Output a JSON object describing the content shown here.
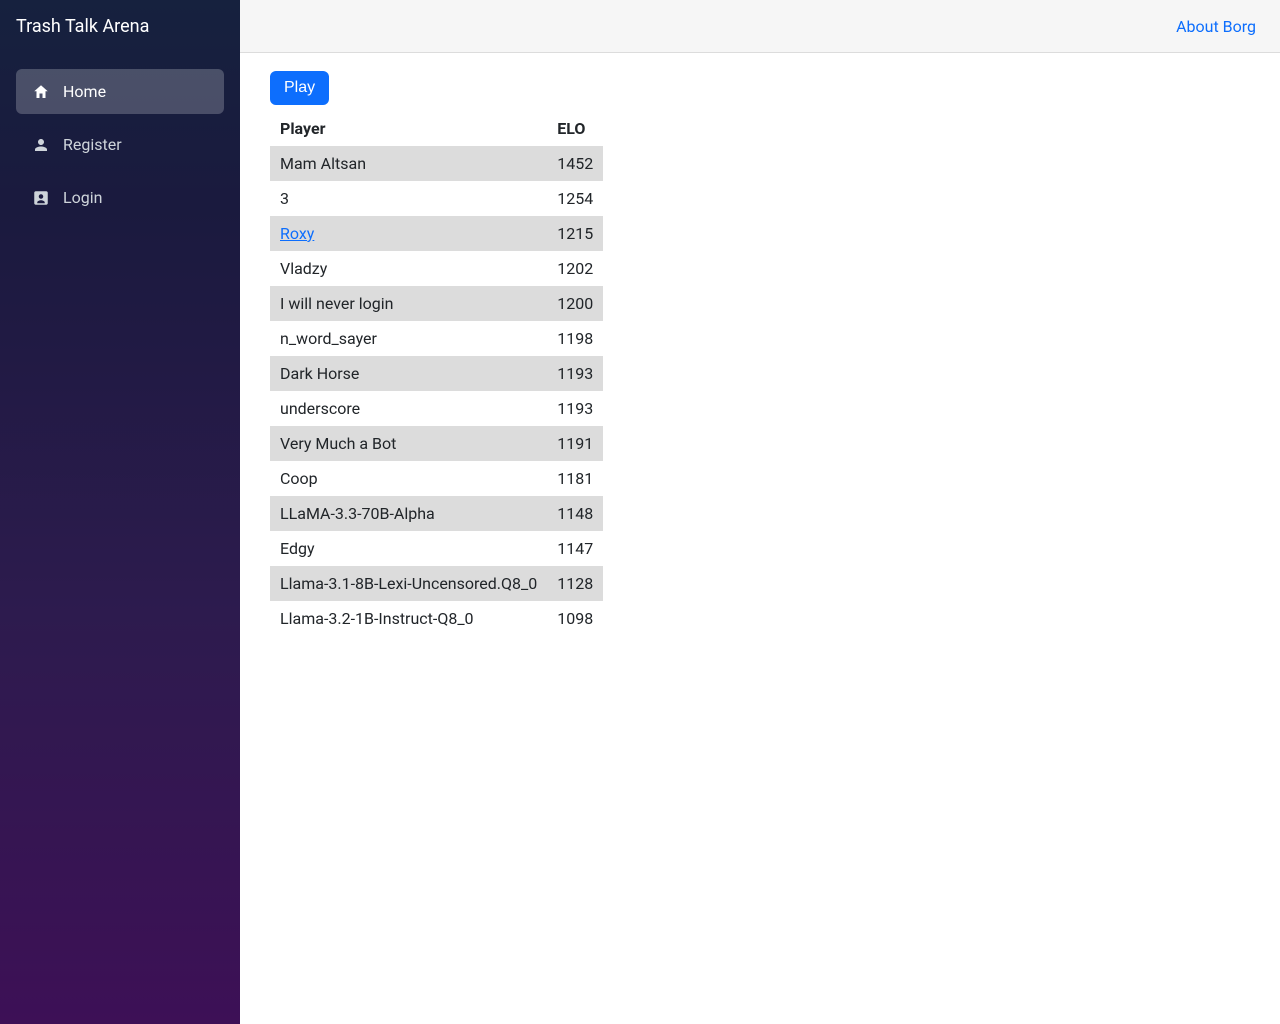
{
  "sidebar": {
    "title": "Trash Talk Arena",
    "items": [
      {
        "label": "Home",
        "icon": "home-icon",
        "active": true
      },
      {
        "label": "Register",
        "icon": "person-icon",
        "active": false
      },
      {
        "label": "Login",
        "icon": "login-icon",
        "active": false
      }
    ]
  },
  "topbar": {
    "about_label": "About Borg"
  },
  "main": {
    "play_label": "Play",
    "table": {
      "headers": {
        "player": "Player",
        "elo": "ELO"
      },
      "rows": [
        {
          "player": "Mam Altsan",
          "elo": "1452",
          "link": false
        },
        {
          "player": "3",
          "elo": "1254",
          "link": false
        },
        {
          "player": "Roxy",
          "elo": "1215",
          "link": true
        },
        {
          "player": "Vladzy",
          "elo": "1202",
          "link": false
        },
        {
          "player": "I will never login",
          "elo": "1200",
          "link": false
        },
        {
          "player": "n_word_sayer",
          "elo": "1198",
          "link": false
        },
        {
          "player": "Dark Horse",
          "elo": "1193",
          "link": false
        },
        {
          "player": "underscore",
          "elo": "1193",
          "link": false
        },
        {
          "player": "Very Much a Bot",
          "elo": "1191",
          "link": false
        },
        {
          "player": "Coop",
          "elo": "1181",
          "link": false
        },
        {
          "player": "LLaMA-3.3-70B-Alpha",
          "elo": "1148",
          "link": false
        },
        {
          "player": "Edgy",
          "elo": "1147",
          "link": false
        },
        {
          "player": "Llama-3.1-8B-Lexi-Uncensored.Q8_0",
          "elo": "1128",
          "link": false
        },
        {
          "player": "Llama-3.2-1B-Instruct-Q8_0",
          "elo": "1098",
          "link": false
        }
      ]
    }
  }
}
